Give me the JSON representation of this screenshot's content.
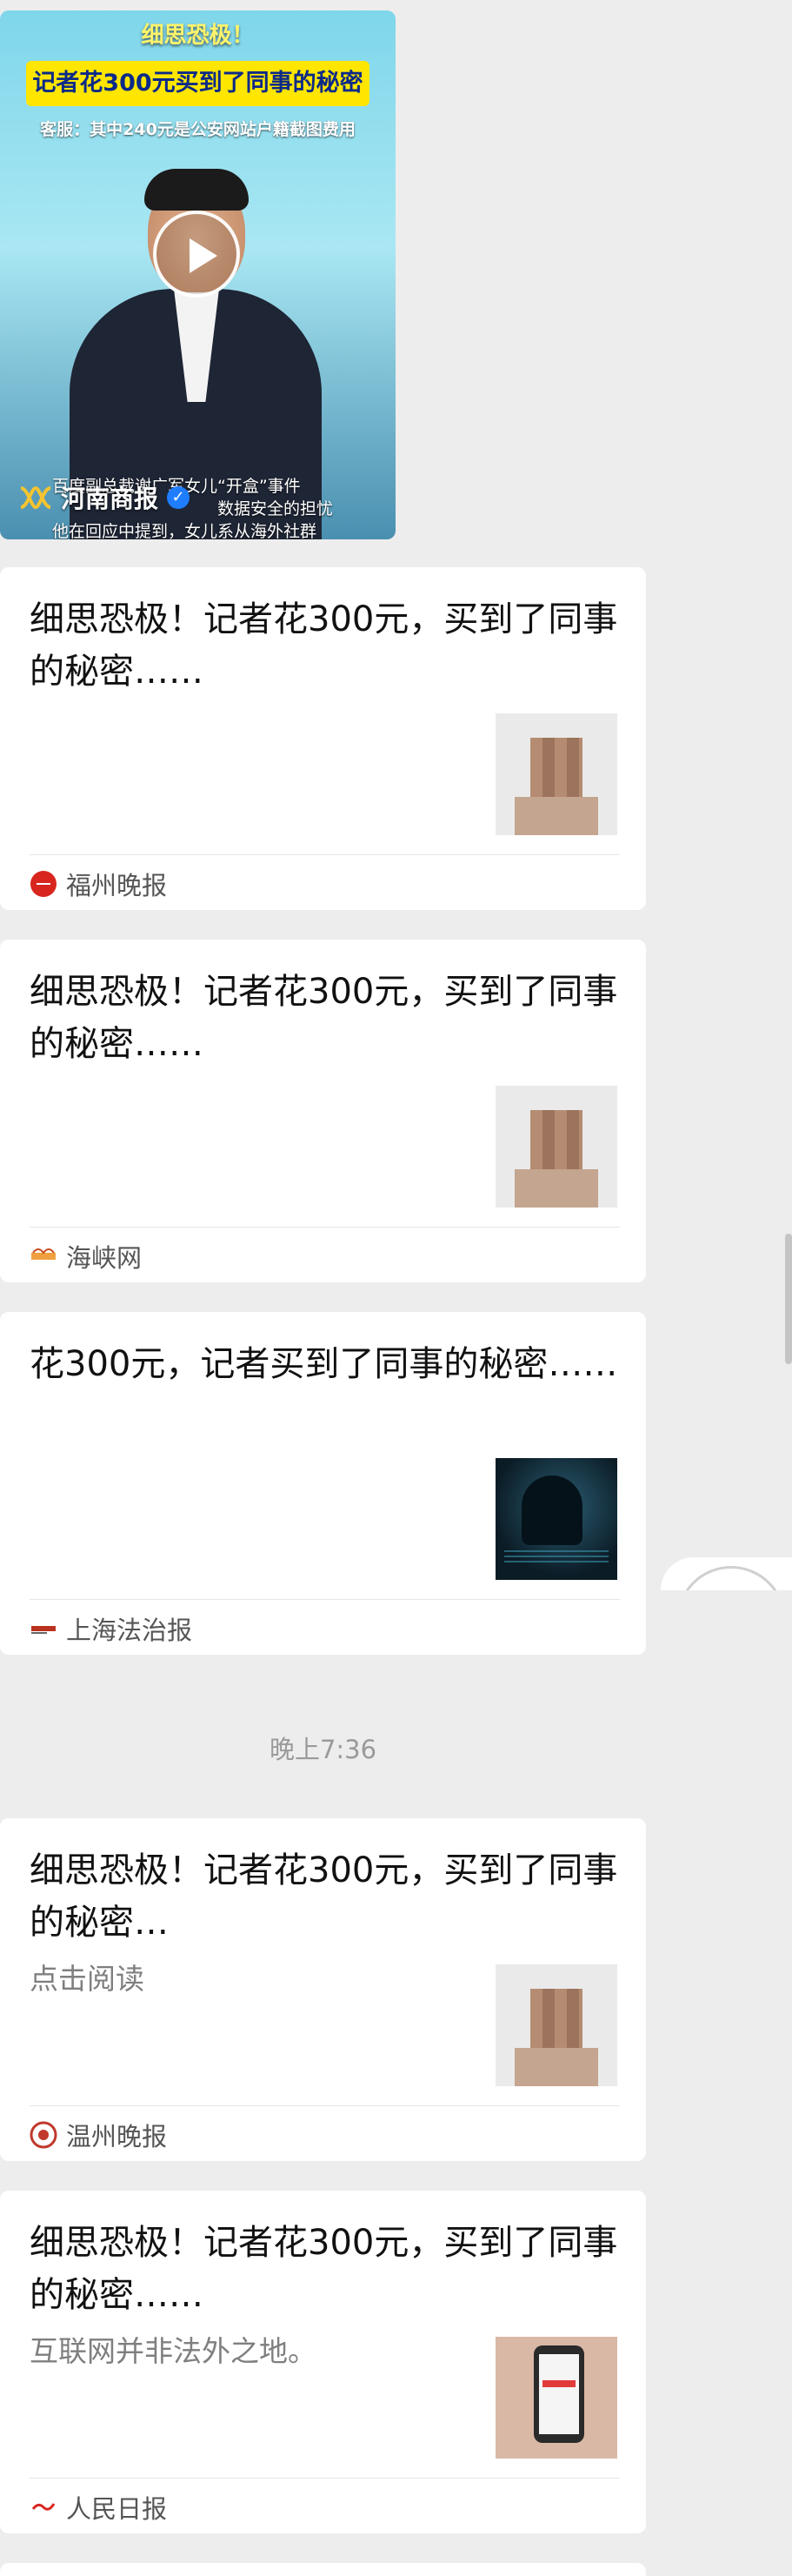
{
  "video": {
    "banner_top": "细思恐极！",
    "banner_main": "记者花300元买到了同事的秘密",
    "banner_sub": "客服：其中240元是公安网站户籍截图费用",
    "caption_lines": [
      "百度副总裁谢广军女儿“开盒”事件",
      "数据安全的担忧",
      "他在回应中提到，女儿系从海外社群"
    ],
    "source_name": "河南商报",
    "verified_icon": "verified-check-icon",
    "play_icon": "play-icon"
  },
  "articles": [
    {
      "title": "细思恐极！记者花300元，买到了同事的秘密……",
      "summary": "",
      "source": "福州晚报",
      "source_icon": "fuzhou-evening-news-logo",
      "thumb": "id-photo-thumbnail"
    },
    {
      "title": "细思恐极！记者花300元，买到了同事的秘密……",
      "summary": "",
      "source": "海峡网",
      "source_icon": "haixia-net-logo",
      "thumb": "id-photo-thumbnail"
    },
    {
      "title": "花300元，记者买到了同事的秘密……",
      "summary": "",
      "source": "上海法治报",
      "source_icon": "shanghai-legal-daily-logo",
      "thumb": "hacker-thumbnail"
    },
    {
      "title": "细思恐极！记者花300元，买到了同事的秘密…",
      "summary": "点击阅读",
      "source": "温州晚报",
      "source_icon": "wenzhou-evening-news-logo",
      "thumb": "id-photo-thumbnail"
    },
    {
      "title": "细思恐极！记者花300元，买到了同事的秘密……",
      "summary": "互联网并非法外之地。",
      "source": "人民日报",
      "source_icon": "peoples-daily-logo",
      "thumb": "phone-thumbnail"
    }
  ],
  "timestamp": "晚上7:36",
  "colors": {
    "background": "#ededed",
    "card": "#ffffff",
    "title_text": "#111111",
    "meta_text": "#555555",
    "banner_yellow": "#ffe600",
    "verified_blue": "#1f7dff"
  }
}
